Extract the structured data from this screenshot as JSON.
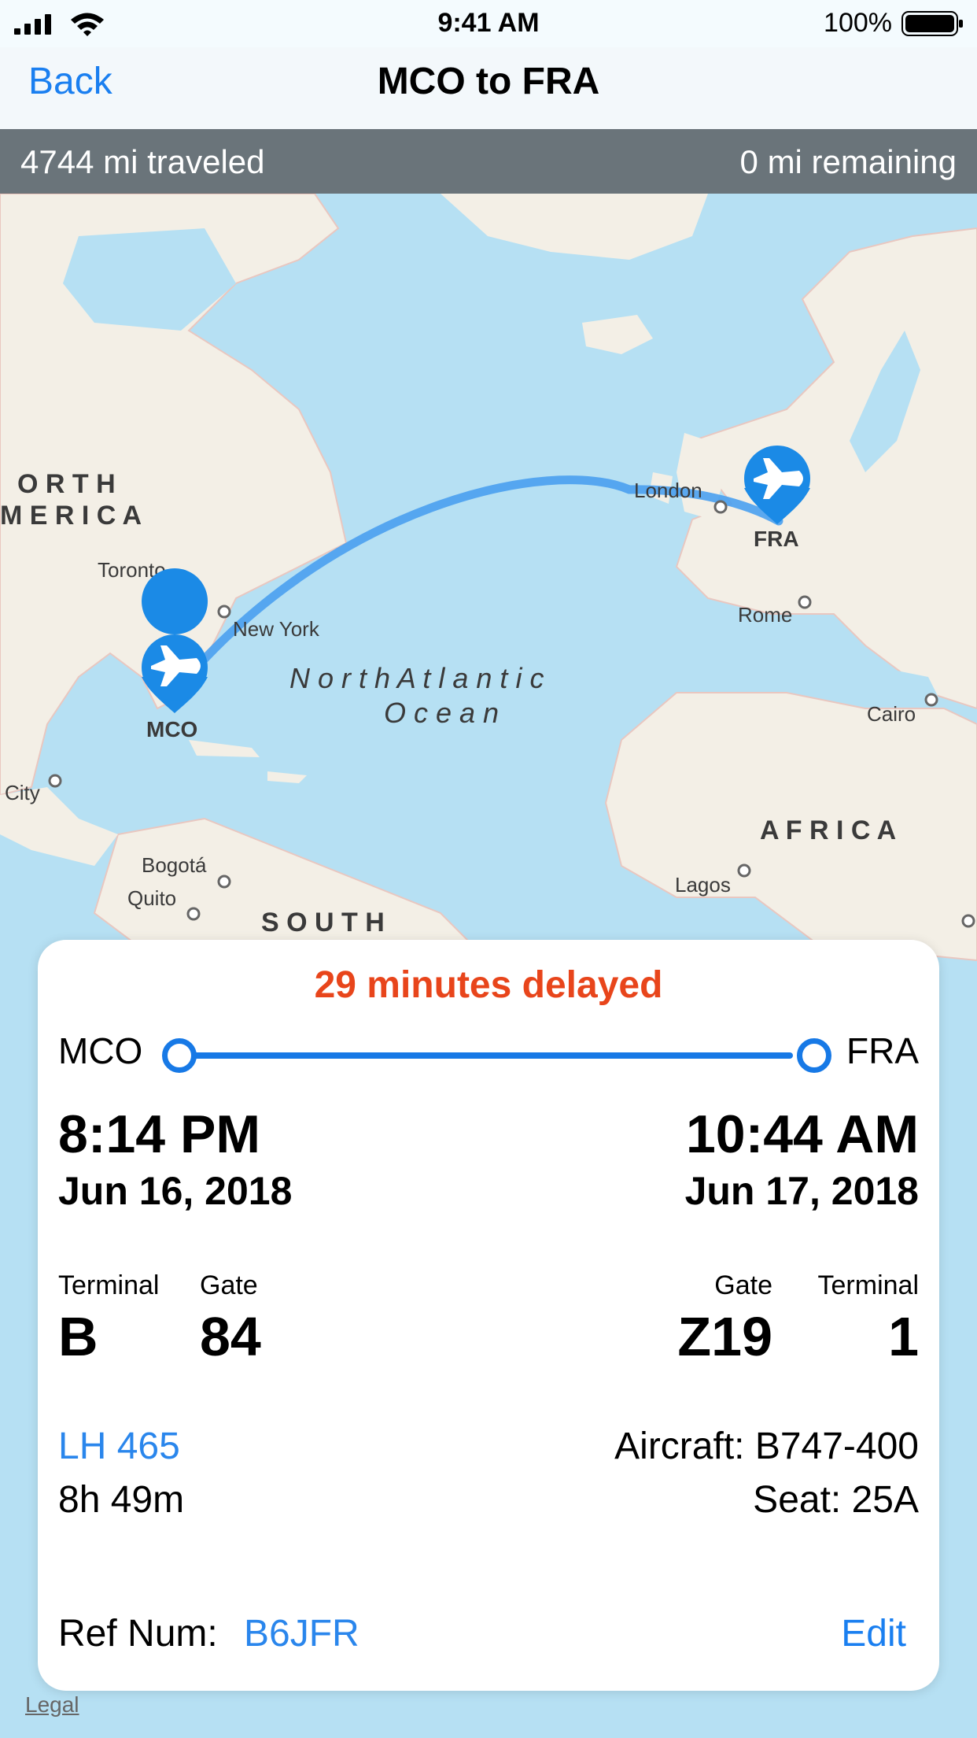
{
  "status_bar": {
    "time": "9:41 AM",
    "battery": "100%"
  },
  "nav": {
    "back_label": "Back",
    "title": "MCO to FRA"
  },
  "progress": {
    "traveled": "4744 mi traveled",
    "remaining": "0 mi remaining"
  },
  "map": {
    "labels": {
      "north_america_1": "O R T H",
      "north_america_2": "M E R I C A",
      "toronto": "Toronto",
      "new_york": "New York",
      "ocean_1": "N o r t h   A t l a n t i c",
      "ocean_2": "O c e a n",
      "london": "London",
      "rome": "Rome",
      "cairo": "Cairo",
      "africa": "A F R I C A",
      "lagos": "Lagos",
      "city": "City",
      "bogota": "Bogotá",
      "quito": "Quito",
      "south_america": "S O U T H",
      "origin_code": "MCO",
      "dest_code": "FRA"
    },
    "legal": "Legal",
    "colors": {
      "water": "#b6e0f3",
      "land": "#f3efe6",
      "route": "#4aa0ef",
      "pin": "#1b8ae6"
    }
  },
  "card": {
    "delay": "29 minutes delayed",
    "origin": "MCO",
    "destination": "FRA",
    "departure": {
      "time": "8:14 PM",
      "date": "Jun 16, 2018",
      "terminal_label": "Terminal",
      "terminal": "B",
      "gate_label": "Gate",
      "gate": "84"
    },
    "arrival": {
      "time": "10:44 AM",
      "date": "Jun 17, 2018",
      "gate_label": "Gate",
      "gate": "Z19",
      "terminal_label": "Terminal",
      "terminal": "1"
    },
    "flight_number": "LH 465",
    "duration": "8h 49m",
    "aircraft": "Aircraft: B747-400",
    "seat": "Seat:  25A",
    "ref_label": "Ref Num:",
    "ref_value": "B6JFR",
    "edit_label": "Edit"
  }
}
